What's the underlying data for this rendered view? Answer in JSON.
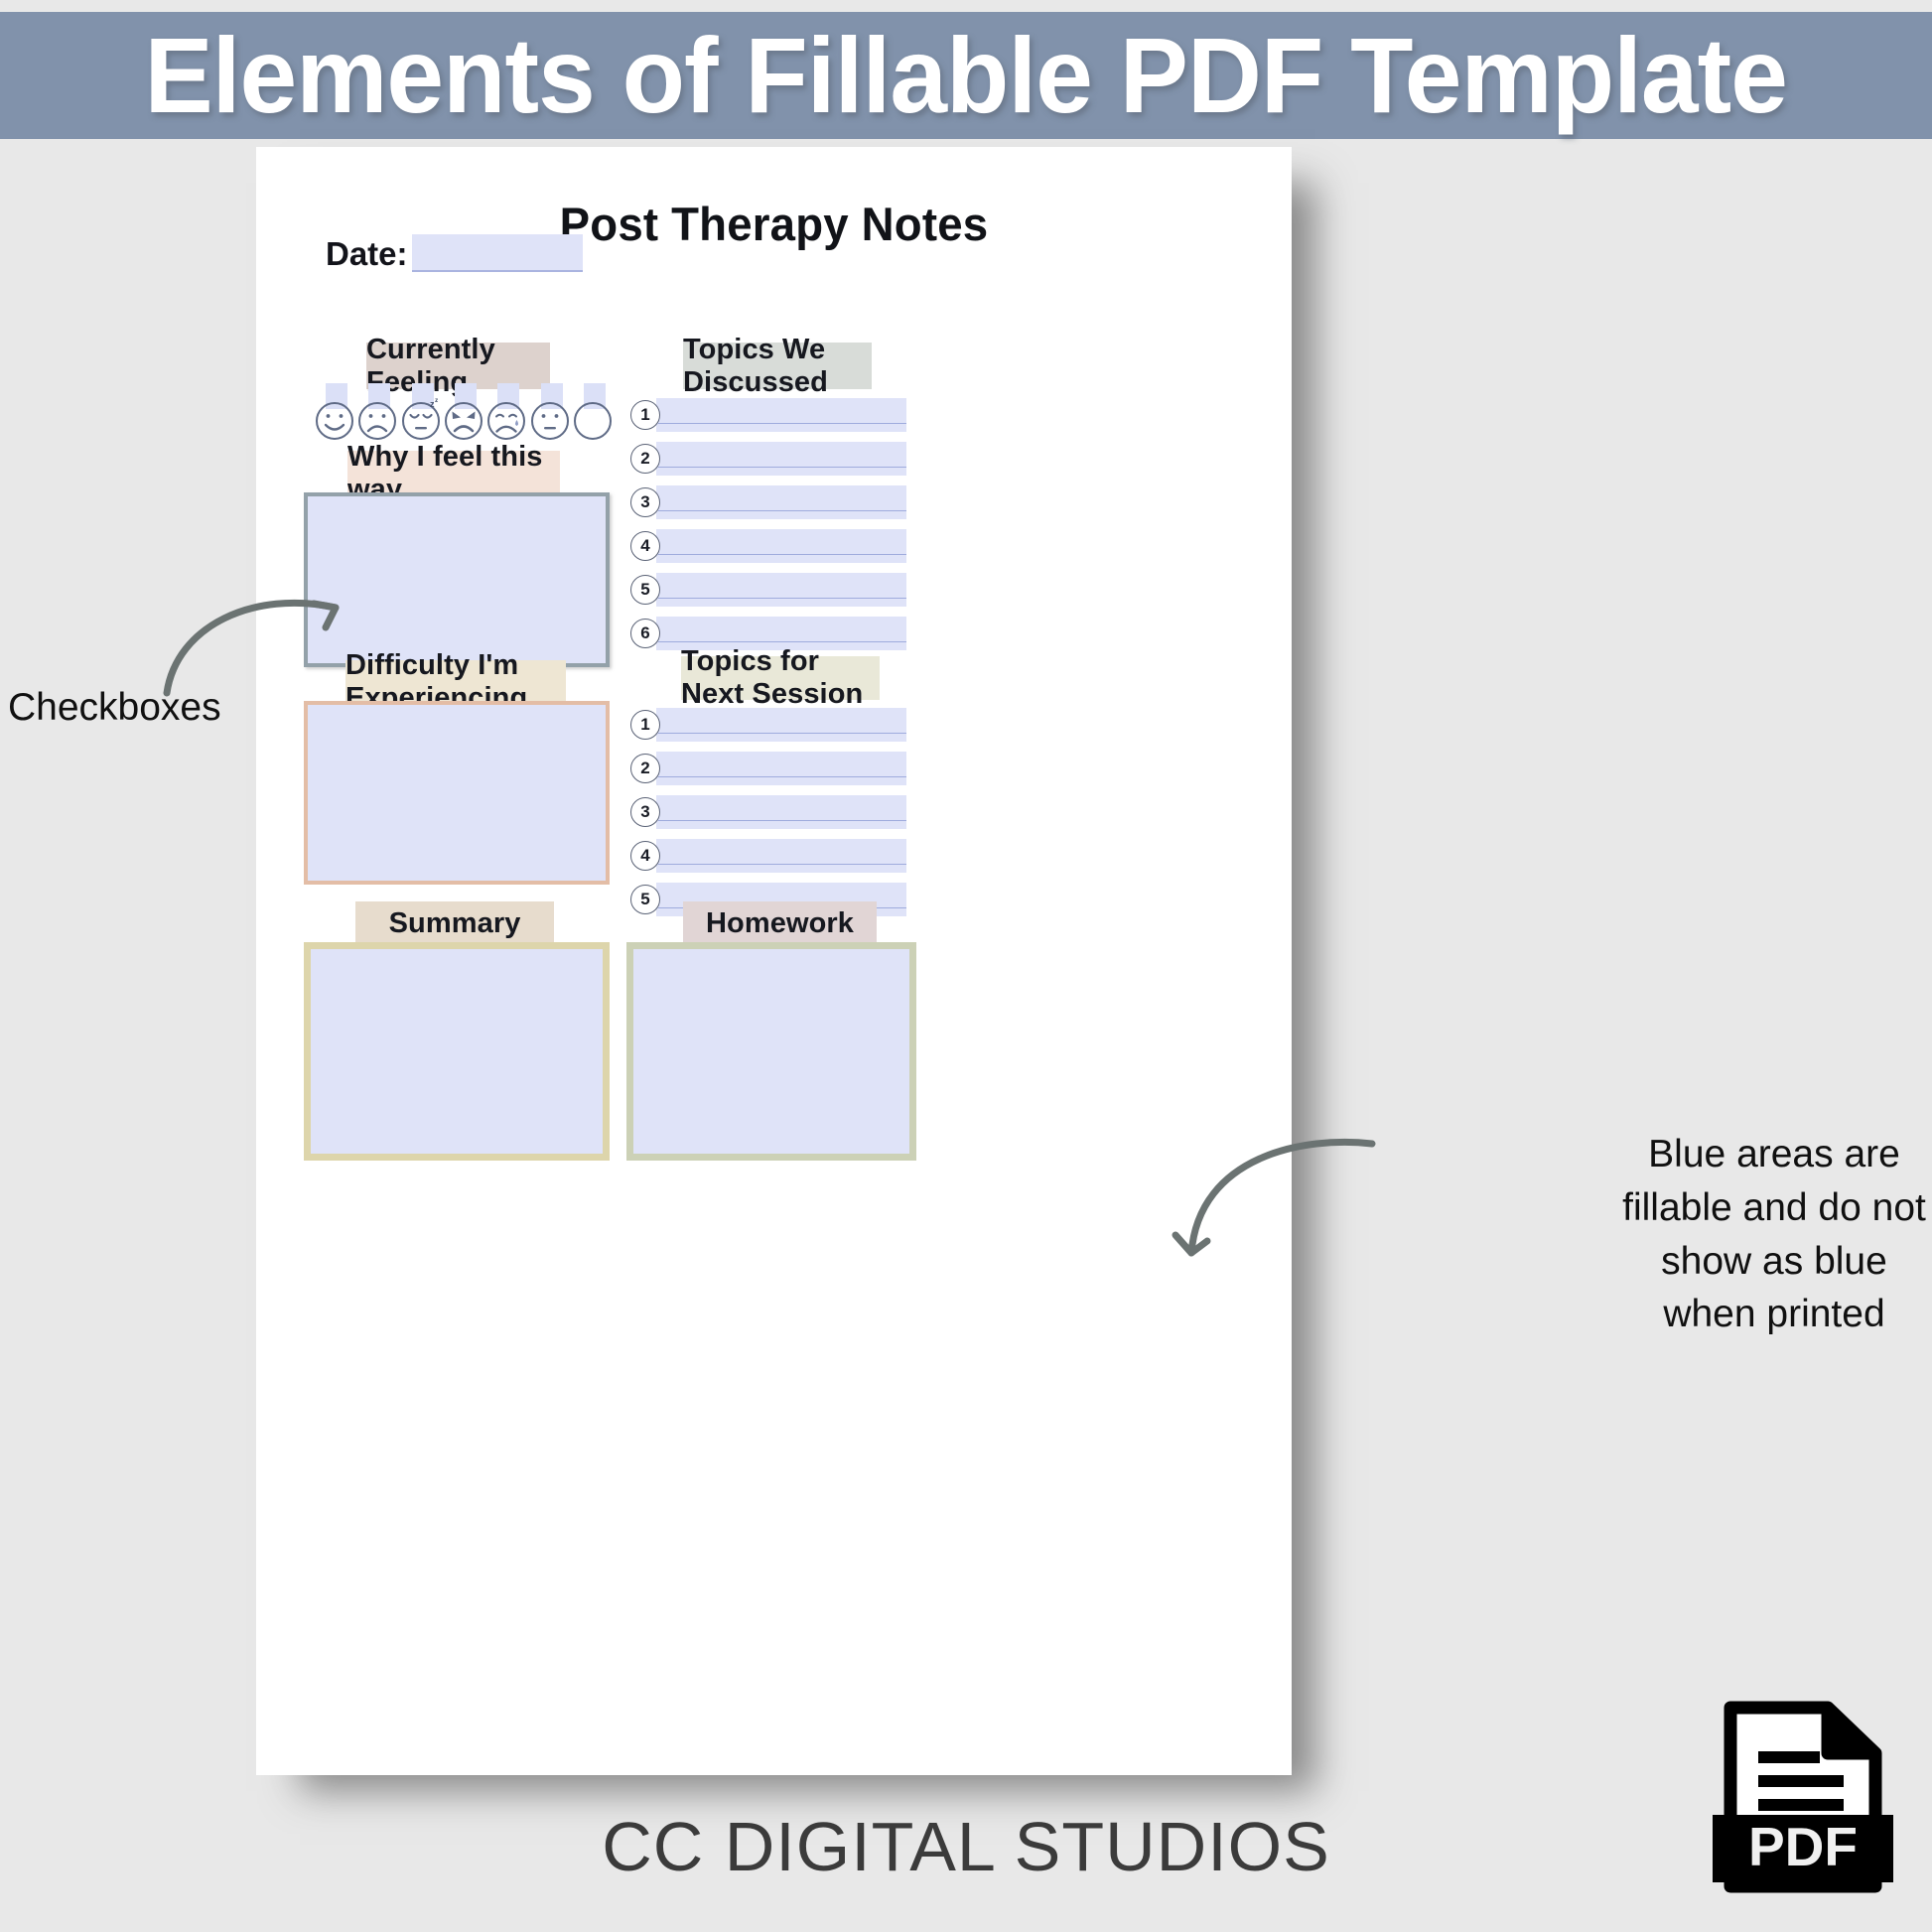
{
  "banner": {
    "title": "Elements of Fillable PDF Template",
    "bg_color": "#8192ab",
    "text_color": "#ffffff"
  },
  "document": {
    "title": "Post Therapy Notes",
    "date": {
      "label": "Date:",
      "value": "",
      "placeholder": ""
    },
    "left_column": {
      "currently_feeling": {
        "header": "Currently Feeling",
        "header_bg": "#ddd2cd",
        "faces": [
          {
            "name": "happy-face",
            "label": "happy",
            "checked": false
          },
          {
            "name": "sad-face",
            "label": "sad",
            "checked": false
          },
          {
            "name": "sleepy-face",
            "label": "sleepy",
            "checked": false
          },
          {
            "name": "angry-face",
            "label": "angry",
            "checked": false
          },
          {
            "name": "crying-face",
            "label": "crying",
            "checked": false
          },
          {
            "name": "neutral-face",
            "label": "neutral",
            "checked": false
          },
          {
            "name": "blank-face",
            "label": "blank",
            "checked": false
          }
        ]
      },
      "why_i_feel": {
        "header": "Why I feel this way",
        "header_bg": "#f4e3d9",
        "border_color": "#93a1a9",
        "fill_color": "#dfe3f8",
        "value": ""
      },
      "difficulty": {
        "header": "Difficulty I'm Experiencing",
        "header_bg": "#eee6d3",
        "border_color": "#e3bda6",
        "fill_color": "#dfe3f8",
        "value": ""
      },
      "summary": {
        "header": "Summary",
        "header_bg": "#e7dccd",
        "border_color": "#ddd5ab",
        "fill_color": "#dfe3f8",
        "value": ""
      }
    },
    "right_column": {
      "topics_discussed": {
        "header": "Topics We Discussed",
        "header_bg": "#d8dcd8",
        "items": [
          {
            "number": "1",
            "value": ""
          },
          {
            "number": "2",
            "value": ""
          },
          {
            "number": "3",
            "value": ""
          },
          {
            "number": "4",
            "value": ""
          },
          {
            "number": "5",
            "value": ""
          },
          {
            "number": "6",
            "value": ""
          }
        ]
      },
      "topics_next_session": {
        "header": "Topics for Next Session",
        "header_bg": "#e9e8d8",
        "items": [
          {
            "number": "1",
            "value": ""
          },
          {
            "number": "2",
            "value": ""
          },
          {
            "number": "3",
            "value": ""
          },
          {
            "number": "4",
            "value": ""
          },
          {
            "number": "5",
            "value": ""
          }
        ]
      },
      "homework": {
        "header": "Homework",
        "header_bg": "#e1d5d5",
        "border_color": "#ccd1b6",
        "fill_color": "#dfe3f8",
        "value": ""
      }
    }
  },
  "annotations": {
    "left": {
      "text": "Checkboxes",
      "arrow": "curved-arrow-up-right"
    },
    "right": {
      "text": "Blue areas are fillable and do not show as blue when printed",
      "arrow": "curved-arrow-down-left"
    },
    "arrow_color": "#6b7372"
  },
  "footer": {
    "brand": "CC DIGITAL STUDIOS",
    "pdf_icon_label": "PDF"
  }
}
